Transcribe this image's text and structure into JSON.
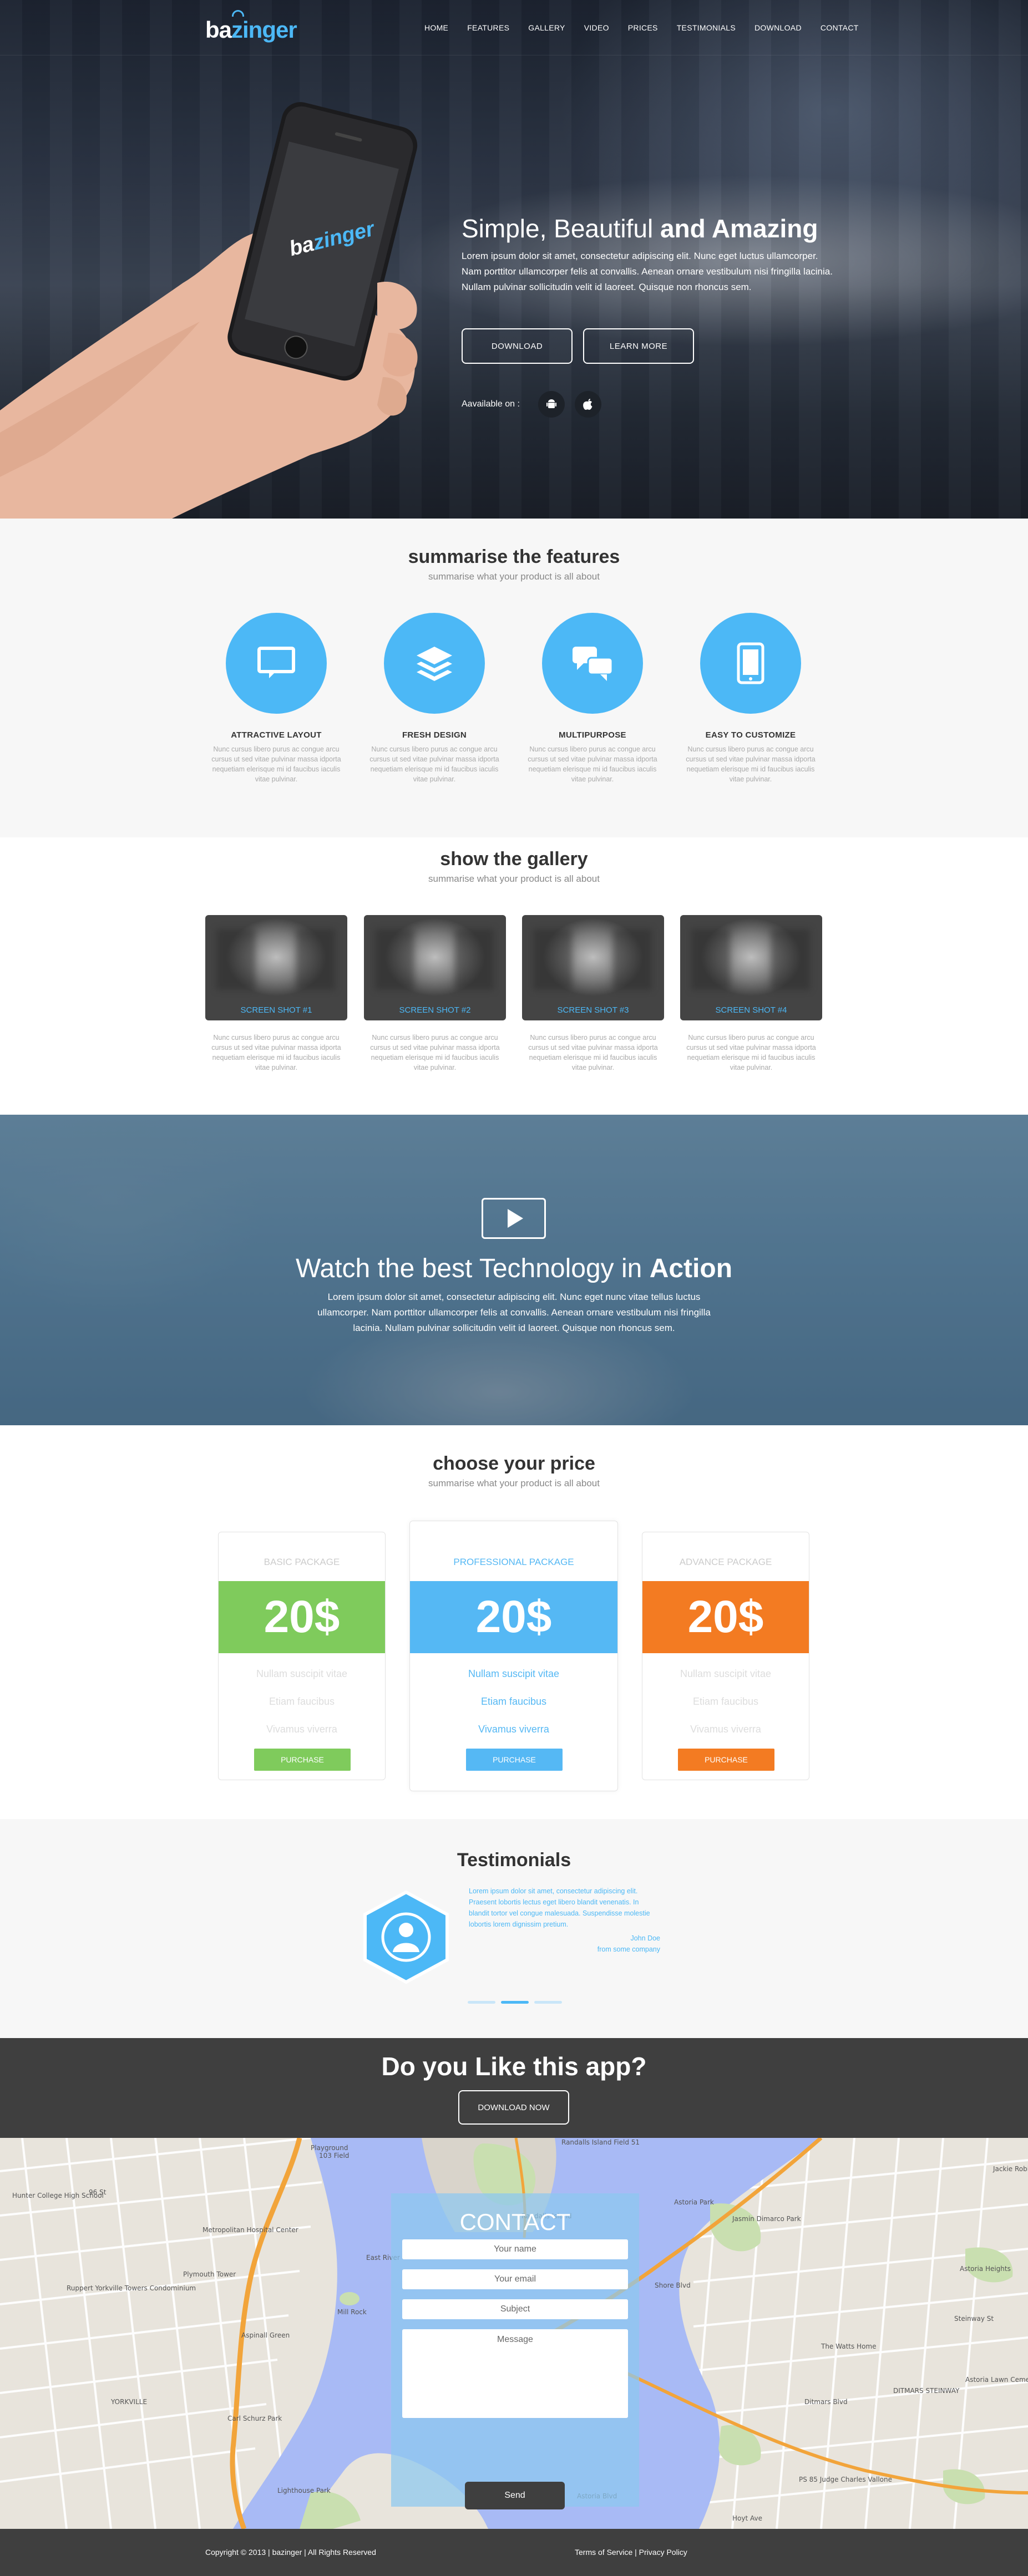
{
  "brand": {
    "name_prefix": "ba",
    "name_suffix": "zinger",
    "accent": "#4cb8f6"
  },
  "nav": {
    "items": [
      "HOME",
      "FEATURES",
      "GALLERY",
      "VIDEO",
      "PRICES",
      "TESTIMONIALS",
      "DOWNLOAD",
      "CONTACT"
    ]
  },
  "hero": {
    "title_light": "Simple, Beautiful ",
    "title_bold": "and Amazing",
    "text": "Lorem ipsum dolor sit amet, consectetur adipiscing elit. Nunc eget luctus ullamcorper. Nam porttitor ullamcorper felis at convallis. Aenean ornare vestibulum nisi fringilla lacinia. Nullam pulvinar sollicitudin velit id laoreet. Quisque non rhoncus sem.",
    "btn_download": "DOWNLOAD",
    "btn_learn": "LEARN MORE",
    "available": "Aavailable on :",
    "phone_logo_prefix": "ba",
    "phone_logo_suffix": "zinger"
  },
  "features": {
    "title": "summarise the features",
    "subtitle": "summarise what your product is all about",
    "items": [
      {
        "label": "ATTRACTIVE LAYOUT",
        "icon": "chat-icon",
        "text": "Nunc cursus libero purus ac congue arcu cursus ut sed vitae pulvinar massa idporta nequetiam elerisque mi id faucibus iaculis vitae pulvinar."
      },
      {
        "label": "FRESH DESIGN",
        "icon": "layers-icon",
        "text": "Nunc cursus libero purus ac congue arcu cursus ut sed vitae pulvinar massa idporta nequetiam elerisque mi id faucibus iaculis vitae pulvinar."
      },
      {
        "label": "MULTIPURPOSE",
        "icon": "conversation-icon",
        "text": "Nunc cursus libero purus ac congue arcu cursus ut sed vitae pulvinar massa idporta nequetiam elerisque mi id faucibus iaculis vitae pulvinar."
      },
      {
        "label": "EASY TO CUSTOMIZE",
        "icon": "tablet-icon",
        "text": "Nunc cursus libero purus ac congue arcu cursus ut sed vitae pulvinar massa idporta nequetiam elerisque mi id faucibus iaculis vitae pulvinar."
      }
    ]
  },
  "gallery": {
    "title": "show the gallery",
    "subtitle": "summarise what your product is all about",
    "items": [
      {
        "caption": "SCREEN SHOT #1",
        "text": "Nunc cursus libero purus ac congue arcu cursus ut sed vitae pulvinar massa idporta nequetiam elerisque mi id faucibus iaculis vitae pulvinar."
      },
      {
        "caption": "SCREEN SHOT #2",
        "text": "Nunc cursus libero purus ac congue arcu cursus ut sed vitae pulvinar massa idporta nequetiam elerisque mi id faucibus iaculis vitae pulvinar."
      },
      {
        "caption": "SCREEN SHOT #3",
        "text": "Nunc cursus libero purus ac congue arcu cursus ut sed vitae pulvinar massa idporta nequetiam elerisque mi id faucibus iaculis vitae pulvinar."
      },
      {
        "caption": "SCREEN SHOT #4",
        "text": "Nunc cursus libero purus ac congue arcu cursus ut sed vitae pulvinar massa idporta nequetiam elerisque mi id faucibus iaculis vitae pulvinar."
      }
    ]
  },
  "video": {
    "title_light": "Watch the best Technology in ",
    "title_bold": "Action",
    "text": "Lorem ipsum dolor sit amet, consectetur adipiscing elit. Nunc eget nunc vitae tellus luctus ullamcorper. Nam porttitor ullamcorper felis at convallis. Aenean ornare vestibulum nisi fringilla lacinia. Nullam pulvinar sollicitudin velit id laoreet. Quisque non rhoncus sem."
  },
  "pricing": {
    "title": "choose your price",
    "subtitle": "summarise what your product is all about",
    "plans": [
      {
        "name": "BASIC PACKAGE",
        "price": "20$",
        "color": "#7fcb5c",
        "features": [
          "Nullam suscipit vitae",
          "Etiam faucibus",
          "Vivamus viverra"
        ],
        "cta": "PURCHASE"
      },
      {
        "name": "PROFESSIONAL PACKAGE",
        "price": "20$",
        "color": "#55b8f4",
        "features": [
          "Nullam suscipit vitae",
          "Etiam faucibus",
          "Vivamus viverra"
        ],
        "cta": "PURCHASE"
      },
      {
        "name": "ADVANCE PACKAGE",
        "price": "20$",
        "color": "#f37b22",
        "features": [
          "Nullam suscipit vitae",
          "Etiam faucibus",
          "Vivamus viverra"
        ],
        "cta": "PURCHASE"
      }
    ]
  },
  "testimonials": {
    "title": "Testimonials",
    "quote": "Lorem ipsum dolor sit amet, consectetur adipiscing elit. Praesent lobortis lectus eget libero blandit venenatis. In blandit tortor vel congue malesuada. Suspendisse molestie lobortis lorem dignissim pretium.",
    "author": "John Doe",
    "company": "from some company"
  },
  "cta": {
    "title": "Do you Like this app?",
    "button": "DOWNLOAD NOW"
  },
  "contact": {
    "title": "CONTACT",
    "name_placeholder": "Your name",
    "email_placeholder": "Your email",
    "subject_placeholder": "Subject",
    "message_placeholder": "Message",
    "send": "Send",
    "map_labels": [
      "Playground",
      "103 Field",
      "Randalls Island Field 51",
      "Hunter College High School",
      "96 St",
      "Metropolitan Hospital Center",
      "Plymouth Tower",
      "Ruppert Yorkville Towers Condominium",
      "Mill Rock",
      "Aspinall Green",
      "Carl Schurz Park",
      "East River",
      "Lighthouse Park",
      "Astoria Park",
      "Jasmin Dimarco Park",
      "The Watts Home",
      "Astoria Heights",
      "PS 85 Judge Charles Vallone",
      "Astoria Blvd",
      "DITMARS STEINWAY",
      "Astoria Lawn Cemetery",
      "Ditmars Blvd",
      "Shore Blvd",
      "Hoyt Ave",
      "Randalls Island",
      "YORKVILLE",
      "Steinway St",
      "Jackie Robinson Park"
    ]
  },
  "footer": {
    "copyright": "Copyright © 2013 | bazinger | All Rights Reserved",
    "terms": "Terms of Service",
    "separator": " | ",
    "privacy": "Privacy Policy"
  }
}
